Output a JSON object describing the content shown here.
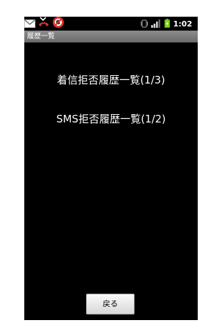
{
  "status_bar": {
    "time": "1:02",
    "left_icons": [
      "mail-icon",
      "missed-call-icon",
      "blocked-app-icon"
    ],
    "right_icons": [
      "vibrate-icon",
      "signal-icon",
      "battery-icon"
    ]
  },
  "title_bar": {
    "title": "履歴一覧"
  },
  "menu": {
    "items": [
      {
        "label": "着信拒否履歴一覧(1/3)"
      },
      {
        "label": "SMS拒否履歴一覧(1/2)"
      }
    ]
  },
  "footer": {
    "back_label": "戻る"
  },
  "colors": {
    "background": "#000000",
    "title_bar": "#7a7a7a",
    "text": "#ffffff",
    "battery": "#7ed321",
    "missed_call": "#e0312a"
  }
}
